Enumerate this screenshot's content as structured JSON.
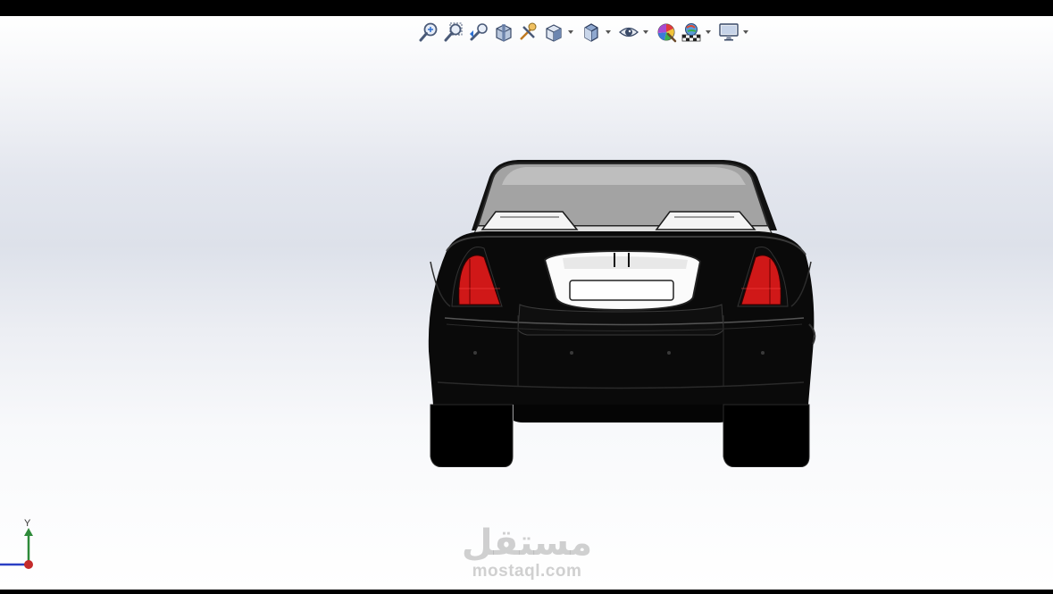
{
  "toolbar": {
    "buttons": [
      {
        "icon": "zoom-to-fit-icon",
        "dropdown": false
      },
      {
        "icon": "zoom-to-area-icon",
        "dropdown": false
      },
      {
        "icon": "previous-view-icon",
        "dropdown": false
      },
      {
        "icon": "section-view-icon",
        "dropdown": false
      },
      {
        "icon": "dynamic-annotation-views-icon",
        "dropdown": false
      },
      {
        "icon": "view-orientation-icon",
        "dropdown": true
      },
      {
        "icon": "display-style-icon",
        "dropdown": true
      },
      {
        "icon": "hide-show-items-icon",
        "dropdown": true
      },
      {
        "icon": "edit-appearance-icon",
        "dropdown": false
      },
      {
        "icon": "apply-scene-icon",
        "dropdown": true
      },
      {
        "icon": "view-settings-icon",
        "dropdown": true
      }
    ]
  },
  "triad": {
    "y_label": "Y",
    "colors": {
      "y": "#2e8b3a",
      "x": "#2b3fc4",
      "origin": "#c42b2b"
    }
  },
  "watermark": {
    "arabic": "مستقل",
    "latin": "mostaql.com"
  },
  "model": {
    "body_color": "#0a0a0a",
    "taillight_color": "#d01818"
  }
}
